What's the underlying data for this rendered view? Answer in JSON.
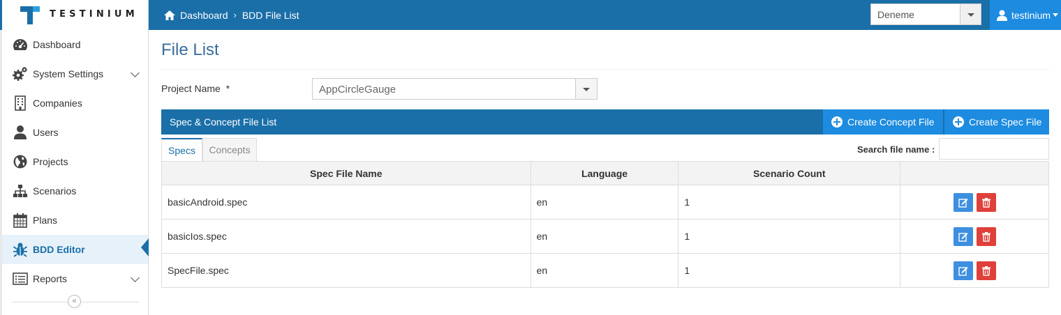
{
  "topbar": {
    "logo_text": "TESTINIUM",
    "breadcrumb": [
      "Dashboard",
      "BDD File List"
    ],
    "project_select_value": "Deneme",
    "user_name": "testinium"
  },
  "sidebar": {
    "items": [
      {
        "label": "Dashboard",
        "icon": "dashboard-icon"
      },
      {
        "label": "System Settings",
        "icon": "cogs-icon",
        "has_children": true
      },
      {
        "label": "Companies",
        "icon": "building-icon"
      },
      {
        "label": "Users",
        "icon": "user-icon"
      },
      {
        "label": "Projects",
        "icon": "globe-icon"
      },
      {
        "label": "Scenarios",
        "icon": "sitemap-icon"
      },
      {
        "label": "Plans",
        "icon": "calendar-icon"
      },
      {
        "label": "BDD Editor",
        "icon": "bug-icon",
        "active": true
      },
      {
        "label": "Reports",
        "icon": "list-icon",
        "has_children": true
      }
    ],
    "collapse_glyph": "«"
  },
  "main": {
    "page_title": "File List",
    "project_name_label": "Project Name  *",
    "project_name_value": "AppCircleGauge",
    "list_title": "Spec & Concept File List",
    "create_concept_label": "Create Concept File",
    "create_spec_label": "Create Spec File",
    "tabs": [
      "Specs",
      "Concepts"
    ],
    "search_label": "Search file name :",
    "search_value": "",
    "table": {
      "headers": [
        "Spec File Name",
        "Language",
        "Scenario Count",
        ""
      ],
      "rows": [
        {
          "name": "basicAndroid.spec",
          "language": "en",
          "count": "1"
        },
        {
          "name": "basicIos.spec",
          "language": "en",
          "count": "1"
        },
        {
          "name": "SpecFile.spec",
          "language": "en",
          "count": "1"
        }
      ]
    }
  },
  "colors": {
    "primary": "#1a6fa8",
    "accent": "#1d8ce0",
    "edit": "#3d8fe0",
    "delete": "#e0403a"
  }
}
